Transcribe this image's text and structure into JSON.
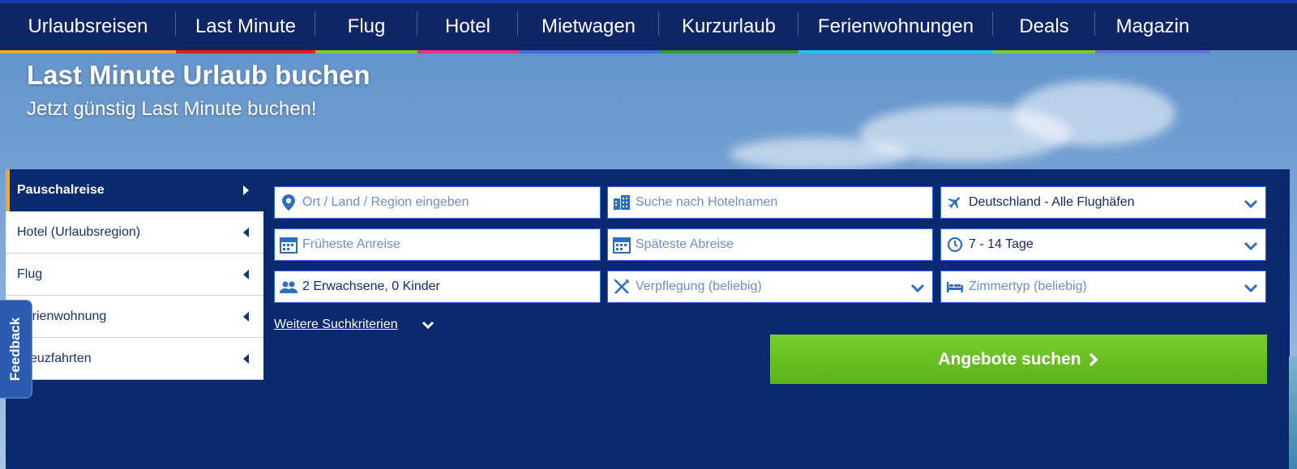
{
  "nav": {
    "items": [
      {
        "label": "Urlaubsreisen",
        "color": "#f6a623"
      },
      {
        "label": "Last Minute",
        "color": "#e02020"
      },
      {
        "label": "Flug",
        "color": "#7bc935"
      },
      {
        "label": "Hotel",
        "color": "#e8337f"
      },
      {
        "label": "Mietwagen",
        "color": "#3f6fd6"
      },
      {
        "label": "Kurzurlaub",
        "color": "#2f9e3a"
      },
      {
        "label": "Ferienwohnungen",
        "color": "#28c2f0"
      },
      {
        "label": "Deals",
        "color": "#7bc935"
      },
      {
        "label": "Magazin",
        "color": "#6a70e0"
      }
    ]
  },
  "hero": {
    "title": "Last Minute Urlaub buchen",
    "subtitle": "Jetzt günstig Last Minute buchen!"
  },
  "tabs": [
    {
      "label": "Pauschalreise",
      "active": true
    },
    {
      "label": "Hotel (Urlaubsregion)",
      "active": false
    },
    {
      "label": "Flug",
      "active": false
    },
    {
      "label": "Ferienwohnung",
      "active": false
    },
    {
      "label": "Kreuzfahrten",
      "active": false
    }
  ],
  "fields": {
    "destination": {
      "placeholder": "Ort / Land / Region eingeben",
      "icon": "map-pin-icon"
    },
    "hotel": {
      "placeholder": "Suche nach Hotelnamen",
      "icon": "building-icon"
    },
    "airport": {
      "value": "Deutschland - Alle Flughäfen",
      "icon": "airplane-icon"
    },
    "departure": {
      "placeholder": "Früheste Anreise",
      "icon": "calendar-icon"
    },
    "return": {
      "placeholder": "Späteste Abreise",
      "icon": "calendar-icon"
    },
    "duration": {
      "value": "7 - 14 Tage",
      "icon": "clock-icon"
    },
    "travelers": {
      "value": "2 Erwachsene, 0 Kinder",
      "icon": "people-icon"
    },
    "board": {
      "placeholder": "Verpflegung (beliebig)",
      "icon": "cutlery-icon"
    },
    "room": {
      "placeholder": "Zimmertyp (beliebig)",
      "icon": "bed-icon"
    }
  },
  "more_criteria": "Weitere Suchkriterien",
  "search_button": "Angebote suchen",
  "feedback": "Feedback",
  "colors": {
    "accent_blue": "#2d6fbd",
    "panel": "#0a2a70",
    "nav": "#0f2566",
    "cta_green": "#6cc024"
  }
}
